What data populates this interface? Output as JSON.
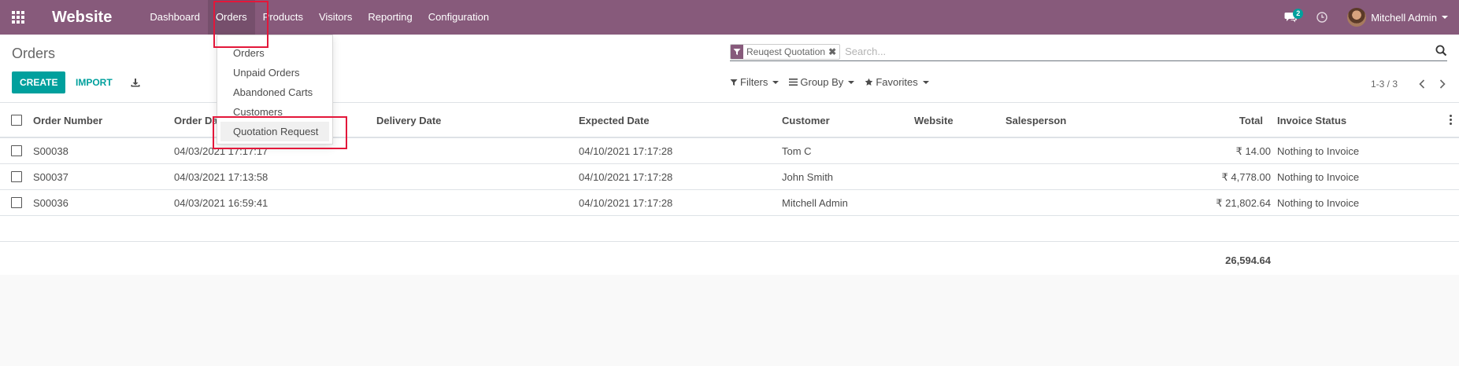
{
  "navbar": {
    "app_name": "Website",
    "menu": [
      "Dashboard",
      "Orders",
      "Products",
      "Visitors",
      "Reporting",
      "Configuration"
    ],
    "active_menu": "Orders",
    "chat_count": "2",
    "user_name": "Mitchell Admin"
  },
  "orders_dropdown": {
    "items": [
      "Orders",
      "Unpaid Orders",
      "Abandoned Carts",
      "Customers",
      "Quotation Request"
    ],
    "hovered": "Quotation Request"
  },
  "control_panel": {
    "title": "Orders",
    "create_label": "CREATE",
    "import_label": "IMPORT",
    "facet_label": "Reuqest Quotation",
    "search_placeholder": "Search...",
    "filters_label": "Filters",
    "groupby_label": "Group By",
    "favorites_label": "Favorites",
    "pager_value": "1-3 / 3"
  },
  "table": {
    "columns": [
      "Order Number",
      "Order Date",
      "Delivery Date",
      "Expected Date",
      "Customer",
      "Website",
      "Salesperson",
      "Total",
      "Invoice Status"
    ],
    "rows": [
      {
        "number": "S00038",
        "order_date": "04/03/2021 17:17:17",
        "delivery_date": "",
        "expected_date": "04/10/2021 17:17:28",
        "customer": "Tom C",
        "website": "",
        "salesperson": "",
        "total": "₹ 14.00",
        "invoice_status": "Nothing to Invoice"
      },
      {
        "number": "S00037",
        "order_date": "04/03/2021 17:13:58",
        "delivery_date": "",
        "expected_date": "04/10/2021 17:17:28",
        "customer": "John Smith",
        "website": "",
        "salesperson": "",
        "total": "₹ 4,778.00",
        "invoice_status": "Nothing to Invoice"
      },
      {
        "number": "S00036",
        "order_date": "04/03/2021 16:59:41",
        "delivery_date": "",
        "expected_date": "04/10/2021 17:17:28",
        "customer": "Mitchell Admin",
        "website": "",
        "salesperson": "",
        "total": "₹ 21,802.64",
        "invoice_status": "Nothing to Invoice"
      }
    ],
    "total_sum": "26,594.64"
  },
  "colors": {
    "brand": "#875a7b",
    "accent": "#00a09d",
    "highlight": "#e3173a"
  }
}
